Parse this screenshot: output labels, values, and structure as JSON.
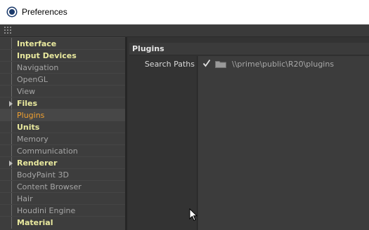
{
  "window": {
    "title": "Preferences",
    "icon": "cinema4d-icon"
  },
  "sidebar": {
    "items": [
      {
        "label": "Interface",
        "style": "bold",
        "arrow": false
      },
      {
        "label": "Input Devices",
        "style": "bold",
        "arrow": false
      },
      {
        "label": "Navigation",
        "style": "muted",
        "arrow": false
      },
      {
        "label": "OpenGL",
        "style": "muted",
        "arrow": false
      },
      {
        "label": "View",
        "style": "muted",
        "arrow": false
      },
      {
        "label": "Files",
        "style": "bold",
        "arrow": true
      },
      {
        "label": "Plugins",
        "style": "selected",
        "arrow": false
      },
      {
        "label": "Units",
        "style": "bold",
        "arrow": false
      },
      {
        "label": "Memory",
        "style": "muted",
        "arrow": false
      },
      {
        "label": "Communication",
        "style": "muted",
        "arrow": false
      },
      {
        "label": "Renderer",
        "style": "bold",
        "arrow": true
      },
      {
        "label": "BodyPaint 3D",
        "style": "muted",
        "arrow": false
      },
      {
        "label": "Content Browser",
        "style": "muted",
        "arrow": false
      },
      {
        "label": "Hair",
        "style": "muted",
        "arrow": false
      },
      {
        "label": "Houdini Engine",
        "style": "muted",
        "arrow": false
      },
      {
        "label": "Material",
        "style": "bold",
        "arrow": false
      }
    ]
  },
  "main": {
    "section_title": "Plugins",
    "search_paths": {
      "label": "Search Paths",
      "entries": [
        {
          "enabled": true,
          "path": "\\\\prime\\public\\R20\\plugins"
        }
      ]
    }
  },
  "colors": {
    "selected": "#f0a030",
    "bold_item": "#e9e99e",
    "muted_item": "#a6a6a6"
  }
}
